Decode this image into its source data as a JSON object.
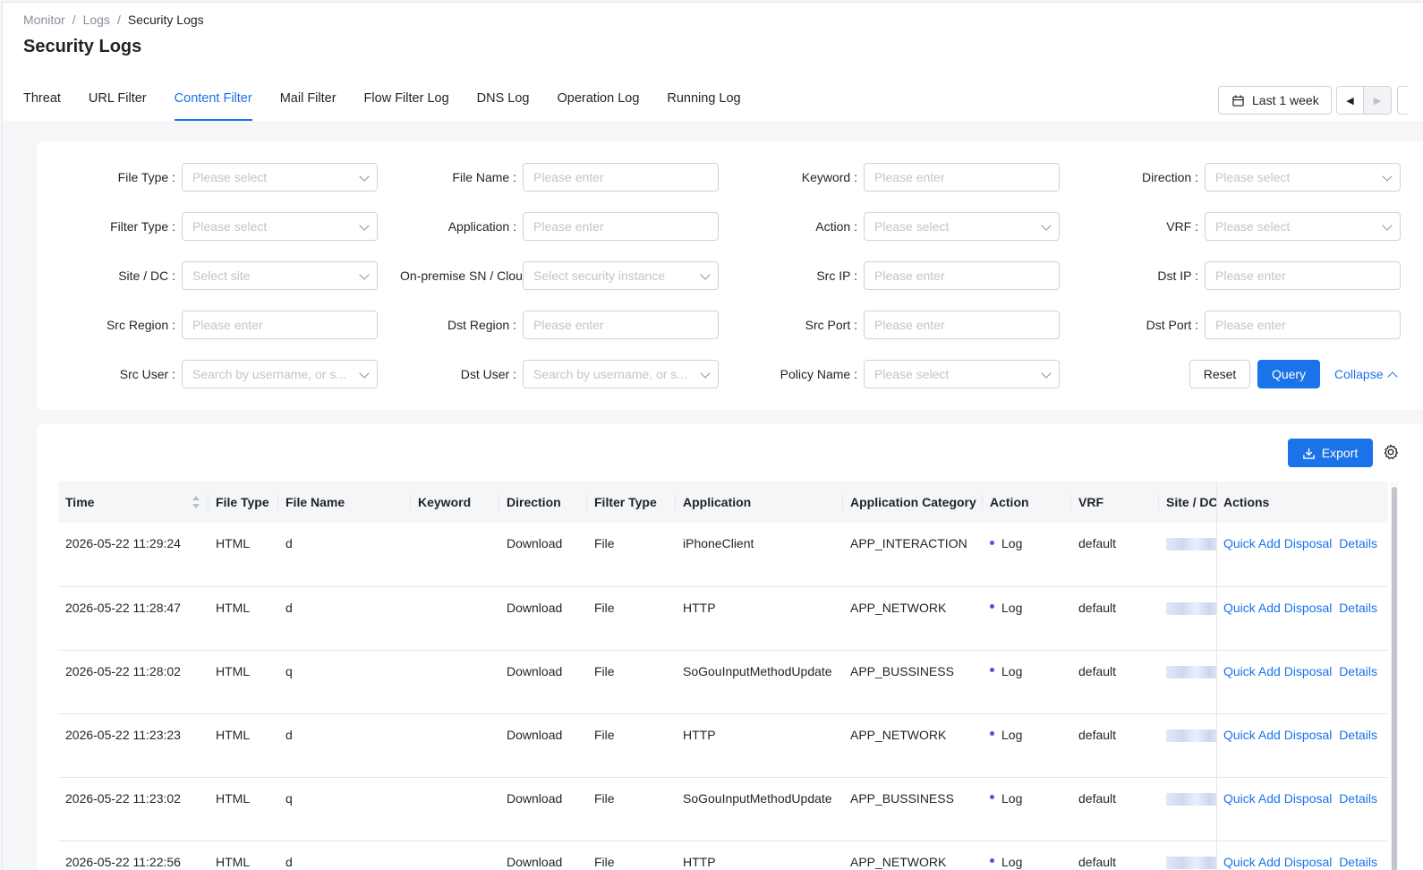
{
  "breadcrumb": [
    "Monitor",
    "Logs",
    "Security Logs"
  ],
  "breadcrumb_sep": "/",
  "page_title": "Security Logs",
  "tabs": [
    "Threat",
    "URL Filter",
    "Content Filter",
    "Mail Filter",
    "Flow Filter Log",
    "DNS Log",
    "Operation Log",
    "Running Log"
  ],
  "active_tab": "Content Filter",
  "time_range": "Last 1 week",
  "filters": {
    "file_type": {
      "label": "File Type",
      "placeholder": "Please select"
    },
    "file_name": {
      "label": "File Name",
      "placeholder": "Please enter"
    },
    "keyword": {
      "label": "Keyword",
      "placeholder": "Please enter"
    },
    "direction": {
      "label": "Direction",
      "placeholder": "Please select"
    },
    "filter_type": {
      "label": "Filter Type",
      "placeholder": "Please select"
    },
    "application": {
      "label": "Application",
      "placeholder": "Please enter"
    },
    "action": {
      "label": "Action",
      "placeholder": "Please select"
    },
    "vrf": {
      "label": "VRF",
      "placeholder": "Please select"
    },
    "site_dc": {
      "label": "Site / DC",
      "placeholder": "Select site"
    },
    "onprem_sn": {
      "label": "On-premise SN / Clou",
      "placeholder": "Select security instance"
    },
    "src_ip": {
      "label": "Src IP",
      "placeholder": "Please enter"
    },
    "dst_ip": {
      "label": "Dst IP",
      "placeholder": "Please enter"
    },
    "src_region": {
      "label": "Src Region",
      "placeholder": "Please enter"
    },
    "dst_region": {
      "label": "Dst Region",
      "placeholder": "Please enter"
    },
    "src_port": {
      "label": "Src Port",
      "placeholder": "Please enter"
    },
    "dst_port": {
      "label": "Dst Port",
      "placeholder": "Please enter"
    },
    "src_user": {
      "label": "Src User",
      "placeholder": "Search by username, or s..."
    },
    "dst_user": {
      "label": "Dst User",
      "placeholder": "Search by username, or s..."
    },
    "policy_name": {
      "label": "Policy Name",
      "placeholder": "Please select"
    },
    "label_colon": ":"
  },
  "buttons": {
    "reset": "Reset",
    "query": "Query",
    "collapse": "Collapse",
    "export": "Export"
  },
  "table": {
    "columns": [
      "Time",
      "File Type",
      "File Name",
      "Keyword",
      "Direction",
      "Filter Type",
      "Application",
      "Application Category",
      "Action",
      "VRF",
      "Site / DC",
      "Actions"
    ],
    "rows": [
      {
        "time": "2026-05-22 11:29:24",
        "file_type": "HTML",
        "file_name": "d",
        "keyword": "",
        "direction": "Download",
        "filter_type": "File",
        "application": "iPhoneClient",
        "app_category": "APP_INTERACTION",
        "action": "Log",
        "vrf": "default"
      },
      {
        "time": "2026-05-22 11:28:47",
        "file_type": "HTML",
        "file_name": "d",
        "keyword": "",
        "direction": "Download",
        "filter_type": "File",
        "application": "HTTP",
        "app_category": "APP_NETWORK",
        "action": "Log",
        "vrf": "default"
      },
      {
        "time": "2026-05-22 11:28:02",
        "file_type": "HTML",
        "file_name": "q",
        "keyword": "",
        "direction": "Download",
        "filter_type": "File",
        "application": "SoGouInputMethodUpdate",
        "app_category": "APP_BUSSINESS",
        "action": "Log",
        "vrf": "default"
      },
      {
        "time": "2026-05-22 11:23:23",
        "file_type": "HTML",
        "file_name": "d",
        "keyword": "",
        "direction": "Download",
        "filter_type": "File",
        "application": "HTTP",
        "app_category": "APP_NETWORK",
        "action": "Log",
        "vrf": "default"
      },
      {
        "time": "2026-05-22 11:23:02",
        "file_type": "HTML",
        "file_name": "q",
        "keyword": "",
        "direction": "Download",
        "filter_type": "File",
        "application": "SoGouInputMethodUpdate",
        "app_category": "APP_BUSSINESS",
        "action": "Log",
        "vrf": "default"
      },
      {
        "time": "2026-05-22 11:22:56",
        "file_type": "HTML",
        "file_name": "d",
        "keyword": "",
        "direction": "Download",
        "filter_type": "File",
        "application": "HTTP",
        "app_category": "APP_NETWORK",
        "action": "Log",
        "vrf": "default"
      }
    ],
    "row_actions": {
      "quick_add": "Quick Add Disposal",
      "details": "Details"
    }
  },
  "colors": {
    "accent": "#1a73e8",
    "log_dot": "#7b3fd6"
  },
  "icons": {
    "time_picker": "calendar-icon",
    "prev": "caret-left-icon",
    "next": "caret-right-icon",
    "export": "download-icon",
    "settings": "gear-icon",
    "sort": "sort-icon",
    "collapse": "chevron-up-icon"
  }
}
